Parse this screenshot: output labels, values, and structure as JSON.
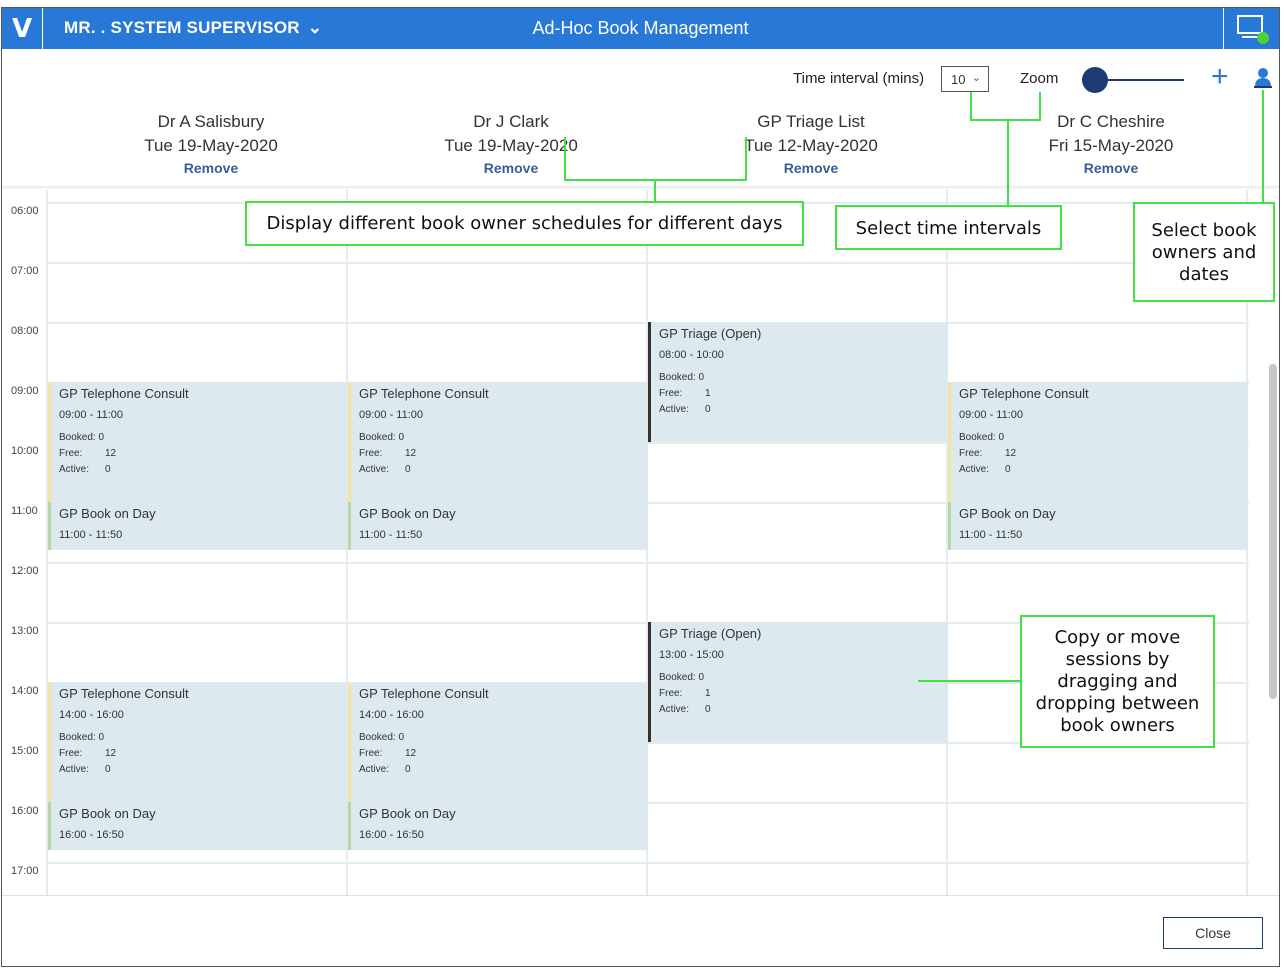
{
  "topbar": {
    "logo": "V",
    "user_name": "MR. . SYSTEM SUPERVISOR",
    "title": "Ad-Hoc Book Management"
  },
  "toolbar": {
    "interval_label": "Time interval (mins)",
    "interval_value": "10",
    "zoom_label": "Zoom"
  },
  "columns": [
    {
      "name": "Dr A Salisbury",
      "date": "Tue 19-May-2020",
      "remove": "Remove"
    },
    {
      "name": "Dr J Clark",
      "date": "Tue 19-May-2020",
      "remove": "Remove"
    },
    {
      "name": "GP Triage List",
      "date": "Tue 12-May-2020",
      "remove": "Remove"
    },
    {
      "name": "Dr C Cheshire",
      "date": "Fri 15-May-2020",
      "remove": "Remove"
    }
  ],
  "times": [
    "06:00",
    "07:00",
    "08:00",
    "09:00",
    "10:00",
    "11:00",
    "12:00",
    "13:00",
    "14:00",
    "15:00",
    "16:00",
    "17:00"
  ],
  "stat_labels": {
    "booked": "Booked:",
    "free": "Free:",
    "active": "Active:"
  },
  "sessions": {
    "c1_tel_am": {
      "title": "GP Telephone Consult",
      "time": "09:00 - 11:00",
      "booked": "0",
      "free": "12",
      "active": "0"
    },
    "c1_bod_am": {
      "title": "GP Book on Day",
      "time": "11:00 - 11:50"
    },
    "c1_tel_pm": {
      "title": "GP Telephone Consult",
      "time": "14:00 - 16:00",
      "booked": "0",
      "free": "12",
      "active": "0"
    },
    "c1_bod_pm": {
      "title": "GP Book on Day",
      "time": "16:00 - 16:50"
    },
    "c2_tel_am": {
      "title": "GP Telephone Consult",
      "time": "09:00 - 11:00",
      "booked": "0",
      "free": "12",
      "active": "0"
    },
    "c2_bod_am": {
      "title": "GP Book on Day",
      "time": "11:00 - 11:50"
    },
    "c2_tel_pm": {
      "title": "GP Telephone Consult",
      "time": "14:00 - 16:00",
      "booked": "0",
      "free": "12",
      "active": "0"
    },
    "c2_bod_pm": {
      "title": "GP Book on Day",
      "time": "16:00 - 16:50"
    },
    "c3_tri_am": {
      "title": "GP Triage (Open)",
      "time": "08:00 - 10:00",
      "booked": "0",
      "free": "1",
      "active": "0"
    },
    "c3_tri_pm": {
      "title": "GP Triage (Open)",
      "time": "13:00 - 15:00",
      "booked": "0",
      "free": "1",
      "active": "0"
    },
    "c4_tel_am": {
      "title": "GP Telephone Consult",
      "time": "09:00 - 11:00",
      "booked": "0",
      "free": "12",
      "active": "0"
    },
    "c4_bod_am": {
      "title": "GP Book on Day",
      "time": "11:00 - 11:50"
    }
  },
  "callouts": {
    "schedules": "Display different book owner schedules for different days",
    "intervals": "Select time intervals",
    "owners": "Select book owners and dates",
    "drag": "Copy or move sessions by dragging and dropping between book owners"
  },
  "footer": {
    "close": "Close"
  },
  "colors": {
    "topbar": "#2878d8",
    "session_bg": "#dce9ee",
    "callout": "#44e144",
    "accent_dark": "#1c3b72"
  }
}
